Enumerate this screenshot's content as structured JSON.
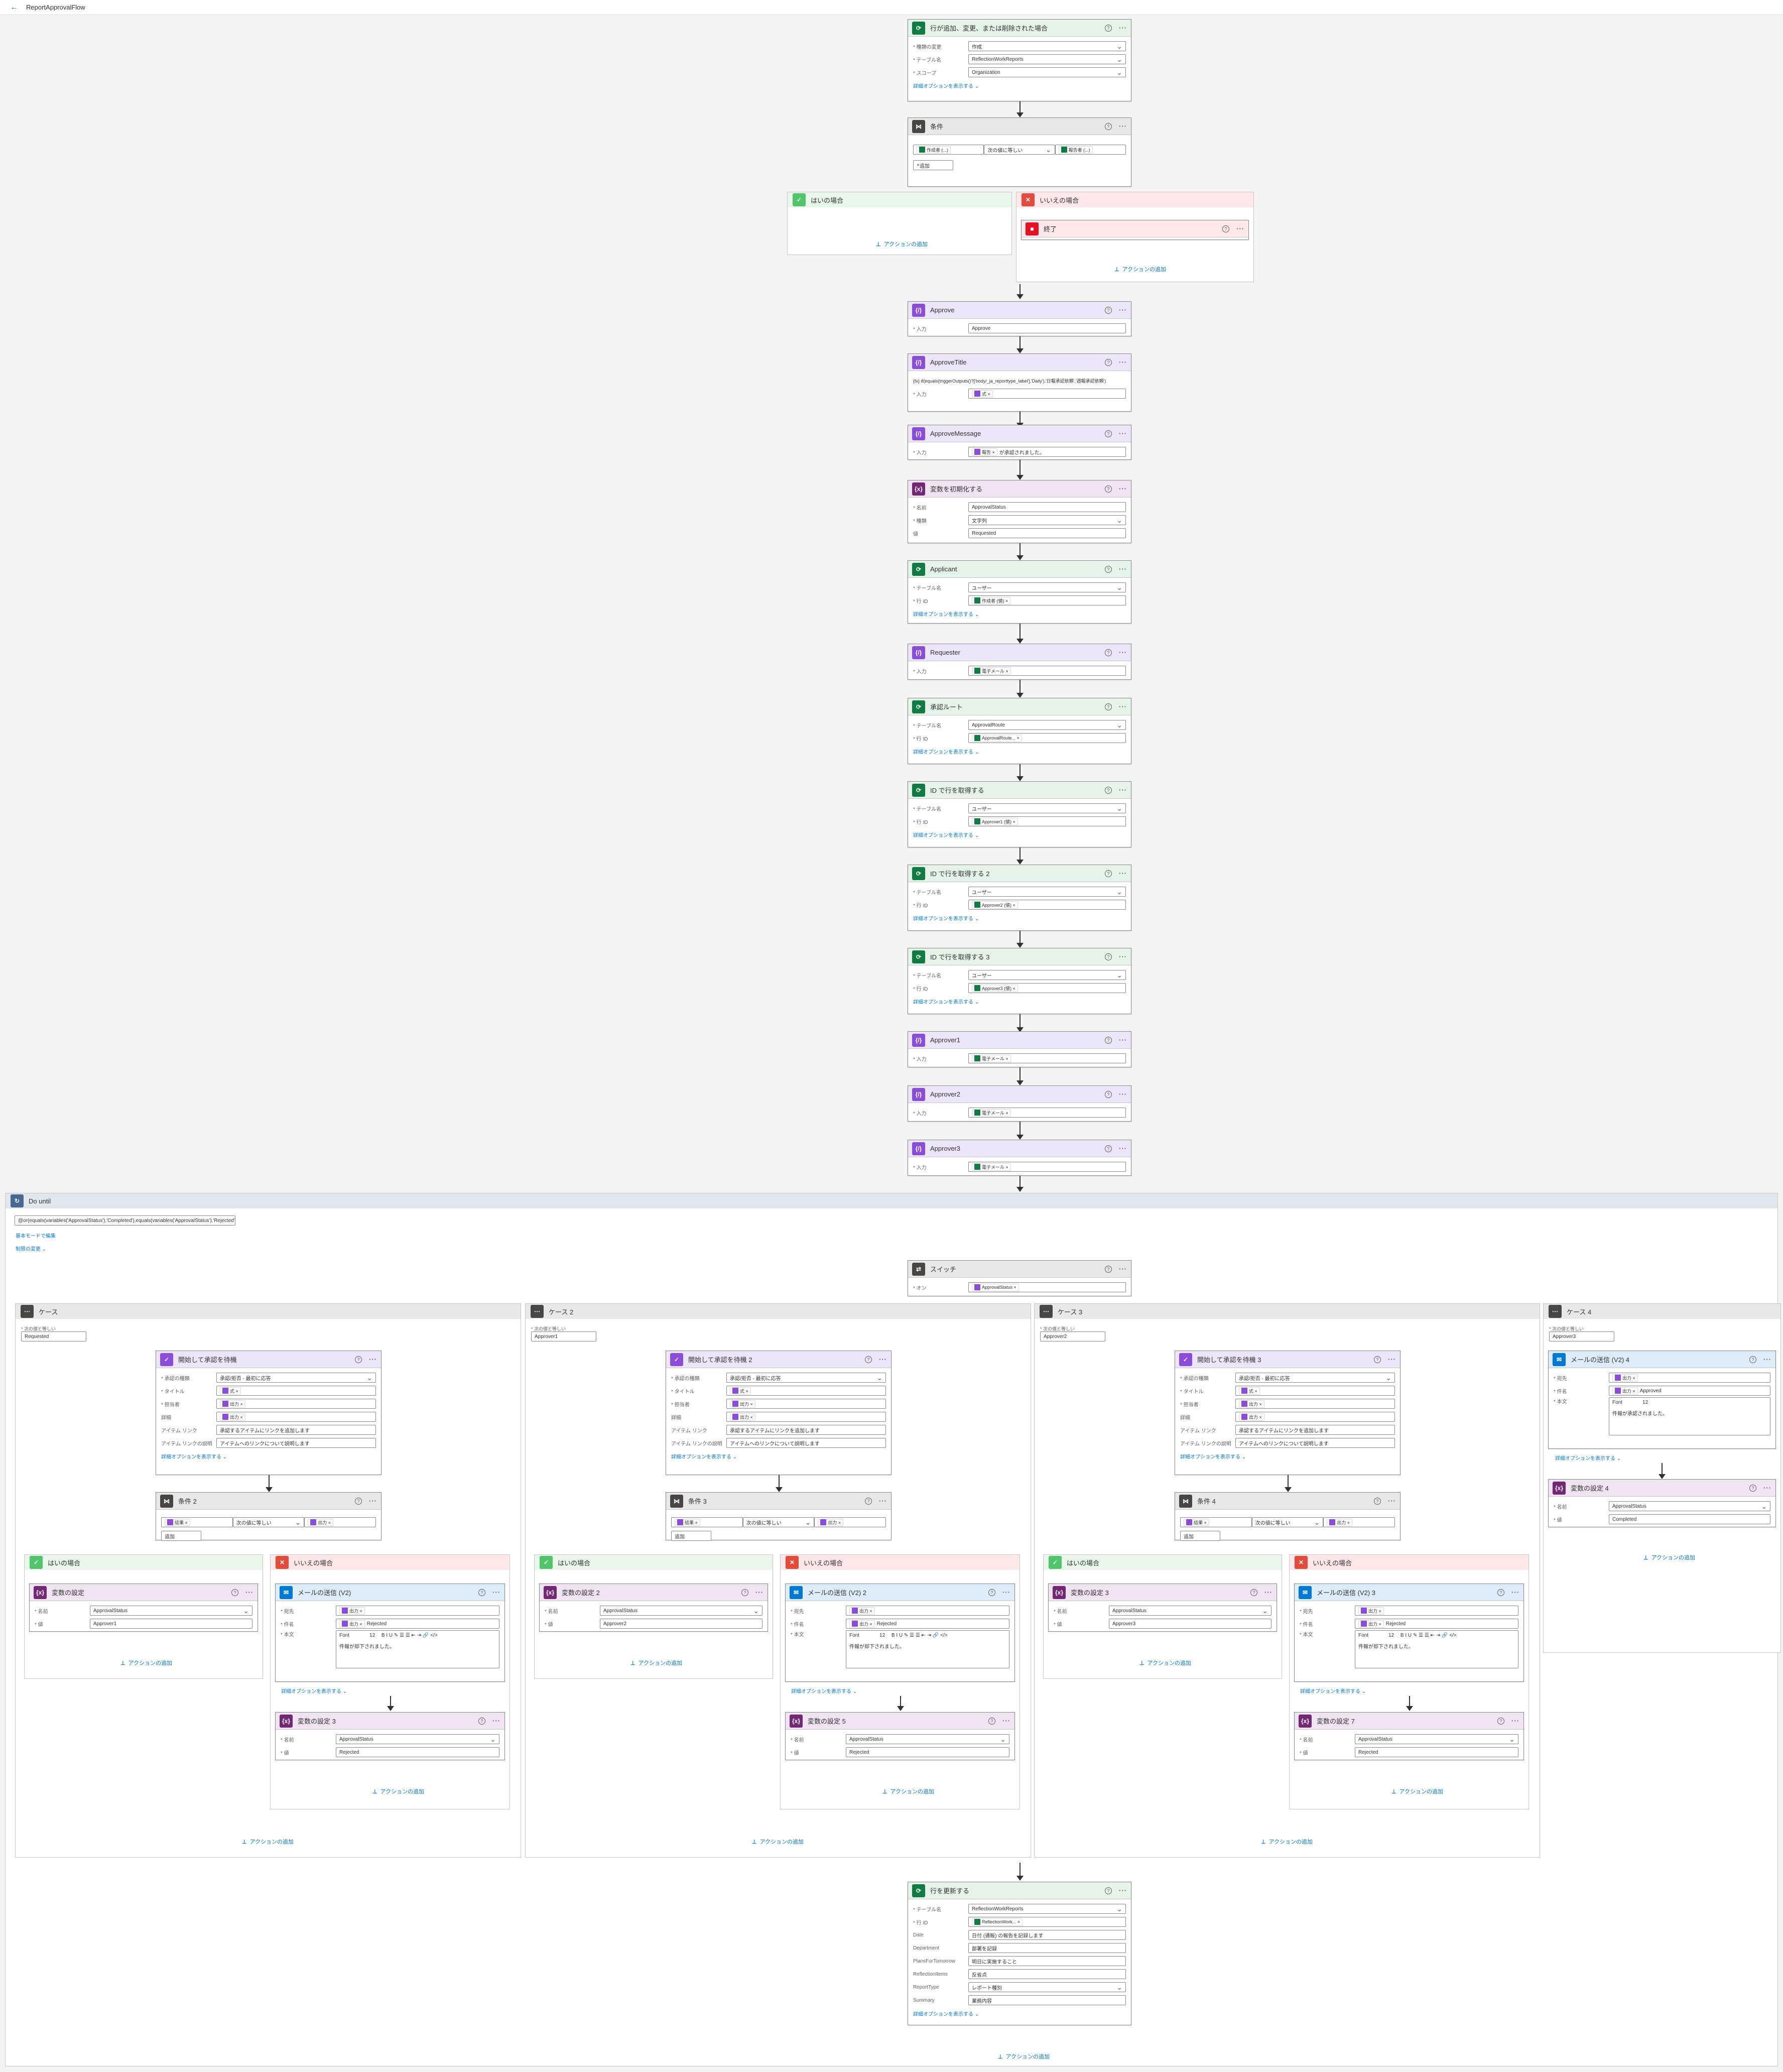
{
  "app": {
    "title": "ReportApprovalFlow"
  },
  "icons": {
    "back": "back-arrow-icon"
  },
  "common": {
    "add_action": "アクションの追加",
    "advanced": "詳細オプションを表示する ⌄",
    "yes": "はいの場合",
    "no": "いいえの場合",
    "add": "追加"
  },
  "trigger": {
    "title": "行が追加、変更、または削除された場合",
    "labels": [
      "* 種類の変更",
      "* テーブル名",
      "* スコープ"
    ],
    "values": [
      "作成",
      "ReflectionWorkReports",
      "Organization"
    ]
  },
  "cond1": {
    "title": "条件",
    "left": "作成者 (...)",
    "op": "次の値に等しい",
    "right": "報告者 (...)"
  },
  "terminate": {
    "title": "終了"
  },
  "compose": [
    {
      "title": "Approve",
      "label": "* 入力",
      "value": "Approve"
    },
    {
      "title": "ApproveTitle",
      "label": "* 入力",
      "value": "",
      "expr": "{fx} if(equals(triggerOutputs()?['body/_ja_reporttype_label'],'Daily'),'日報承認依頼','週報承認依頼')",
      "token": "式 ×"
    },
    {
      "title": "ApproveMessage",
      "label": "* 入力",
      "token": "報告 ×",
      "value": "が承認されました。"
    }
  ],
  "initvar": {
    "title": "変数を初期化する",
    "labels": [
      "* 名前",
      "* 種類",
      "値"
    ],
    "values": [
      "ApprovalStatus",
      "文字列",
      "Requested"
    ]
  },
  "applicant": {
    "title": "Applicant",
    "labels": [
      "* テーブル名",
      "* 行 ID"
    ],
    "values": [
      "ユーザー"
    ],
    "token": "作成者 (値) ×"
  },
  "requester": {
    "title": "Requester",
    "label": "* 入力",
    "token": "電子メール ×"
  },
  "route": {
    "title": "承認ルート",
    "labels": [
      "* テーブル名",
      "* 行 ID"
    ],
    "values": [
      "ApprovalRoute"
    ],
    "token": "ApprovalRoute... ×"
  },
  "getrows": [
    {
      "title": "ID で行を取得する",
      "value": "ユーザー",
      "token": "Approver1 (値) ×"
    },
    {
      "title": "ID で行を取得する 2",
      "value": "ユーザー",
      "token": "Approver2 (値) ×"
    },
    {
      "title": "ID で行を取得する 3",
      "value": "ユーザー",
      "token": "Approver3 (値) ×"
    }
  ],
  "getrow_labels": [
    "* テーブル名",
    "* 行 ID"
  ],
  "approvers": [
    {
      "title": "Approver1",
      "label": "* 入力",
      "token": "電子メール ×"
    },
    {
      "title": "Approver2",
      "label": "* 入力",
      "token": "電子メール ×"
    },
    {
      "title": "Approver3",
      "label": "* 入力",
      "token": "電子メール ×"
    }
  ],
  "dountil": {
    "title": "Do until",
    "expr": "@or(equals(variables('ApprovalStatus'),'Completed'),equals(variables('ApprovalStatus'),'Rejected'))",
    "edit": "基本モードで編集",
    "limit": "制限の変更 ⌄"
  },
  "switch": {
    "title": "スイッチ",
    "label": "* オン",
    "token": "ApprovalStatus ×"
  },
  "case_eq_label": "* 次の値と等しい",
  "cases": [
    {
      "title": "ケース",
      "value": "Requested",
      "wait": "開始して承認を待機",
      "cond": "条件 2",
      "setyes": "変数の設定",
      "yesval": "Approver1",
      "mail": "メールの送信 (V2)",
      "setno": "変数の設定 3"
    },
    {
      "title": "ケース 2",
      "value": "Approver1",
      "wait": "開始して承認を待機 2",
      "cond": "条件 3",
      "setyes": "変数の設定 2",
      "yesval": "Approver2",
      "mail": "メールの送信 (V2) 2",
      "setno": "変数の設定 5"
    },
    {
      "title": "ケース 3",
      "value": "Approver2",
      "wait": "開始して承認を待機 3",
      "cond": "条件 4",
      "setyes": "変数の設定 3",
      "yesval": "Approver3",
      "mail": "メールの送信 (V2) 3",
      "setno": "変数の設定 7"
    }
  ],
  "wait_labels": [
    "* 承認の種類",
    "* タイトル",
    "* 担当者",
    "詳細",
    "アイテム リンク",
    "アイテム リンクの説明"
  ],
  "wait_values": [
    "承認/拒否 - 最初に応答",
    "式 ×",
    "出力 ×",
    "出力 ×",
    "承認するアイテムにリンクを追加します",
    "アイテムへのリンクについて説明します"
  ],
  "cond_left": "結果 ×",
  "cond_op": "次の値に等しい",
  "cond_right": "出力 ×",
  "mail_labels": [
    "* 宛先",
    "* 件名",
    "* 本文"
  ],
  "mail_to": "出力 ×",
  "mail_subject_token": "出力 ×",
  "mail_subject": "Rejected",
  "mail_body": "件報が却下されました。",
  "mail_font": "Font",
  "mail_size": "12",
  "setvar_labels": [
    "* 名前",
    "* 値"
  ],
  "setvar_name": "ApprovalStatus",
  "rejected": "Rejected",
  "case4": {
    "title": "ケース 4",
    "value": "Approver3",
    "mail": "メールの送信 (V2) 4",
    "to": "出力 ×",
    "subj_tok": "出力 ×",
    "subj": "Approved",
    "body": "件報が承認されました。",
    "set": "変数の設定 4",
    "name": "ApprovalStatus",
    "val": "Completed"
  },
  "update": {
    "title": "行を更新する",
    "labels": [
      "* テーブル名",
      "* 行 ID",
      "Date",
      "Department",
      "PlansForTomorrow",
      "ReflectionItems",
      "ReportType",
      "Summary"
    ],
    "values": [
      "ReflectionWorkReports",
      "",
      "日付 (通販) の報告を記録します",
      "部署を記録",
      "明日に実施すること",
      "反省点",
      "レポート種別",
      "業務内容"
    ],
    "token": "ReflectionWork... ×"
  }
}
